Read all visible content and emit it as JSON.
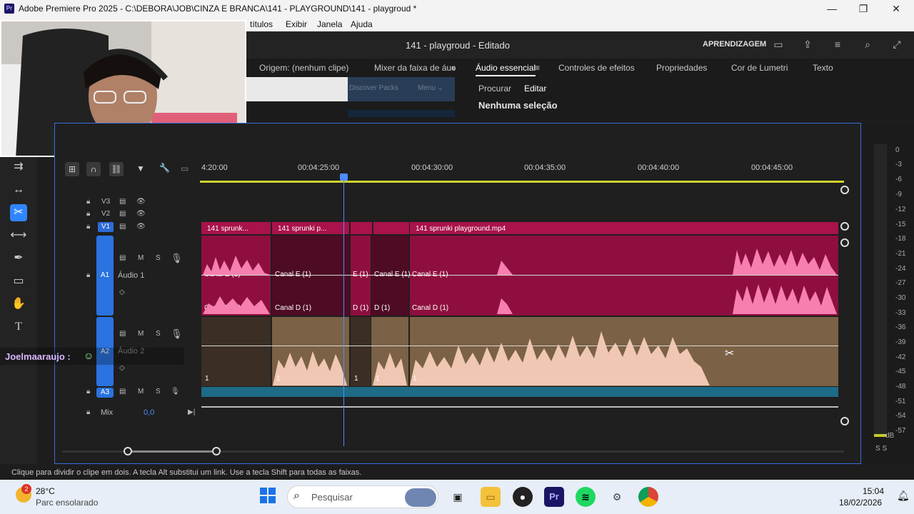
{
  "titlebar": {
    "app_icon": "Pr",
    "title": "Adobe Premiere Pro 2025 - C:\\DEBORA\\JOB\\CINZA E BRANCA\\141 - PLAYGROUND\\141 - playgroud *",
    "minimize_icon": "—",
    "restore_icon": "❐",
    "close_icon": "✕"
  },
  "menu": [
    "títulos",
    "Exibir",
    "Janela",
    "Ajuda"
  ],
  "header": {
    "project_title": "141 - playgroud - Editado",
    "learn": "APRENDIZAGEM"
  },
  "tabs": {
    "source": "Origem: (nenhum clipe)",
    "mixer": "Mixer da faixa de áuc",
    "more": "»",
    "essential_audio": "Áudio essencial",
    "effect_controls": "Controles de efeitos",
    "properties": "Propriedades",
    "lumetri": "Cor de Lumetri",
    "text": "Texto"
  },
  "source_preview": {
    "discover": "Discover Packs",
    "menu": "Menu ⌄"
  },
  "essential_audio": {
    "browse": "Procurar",
    "edit": "Editar",
    "no_selection": "Nenhuma seleção"
  },
  "ruler": {
    "timecodes": [
      "4:20:00",
      "00:04:25:00",
      "00:04:30:00",
      "00:04:35:00",
      "00:04:40:00",
      "00:04:45:00"
    ]
  },
  "tracks": {
    "v3": "V3",
    "v2": "V2",
    "v1": "V1",
    "a1": "A1",
    "a1_name": "Áudio 1",
    "a2": "A2",
    "a2_name": "Áudio 2",
    "a3": "A3",
    "mix": "Mix",
    "mix_value": "0,0",
    "m": "M",
    "s": "S"
  },
  "clips": {
    "v1": [
      "141 sprunk...",
      "141 sprunki p...",
      "141 sprunki playground.mp4"
    ],
    "ch_left": "Canal E (1)",
    "ch_right": "Canal D (1)",
    "e_short": "E (1)",
    "d_short": "D (1)",
    "one": "1"
  },
  "meter": {
    "db_labels": [
      "0",
      "-3",
      "-6",
      "-9",
      "-12",
      "-15",
      "-18",
      "-21",
      "-24",
      "-27",
      "-30",
      "-33",
      "-36",
      "-39",
      "-42",
      "-45",
      "-48",
      "-51",
      "-54",
      "-57",
      "dB"
    ],
    "solo": "S S"
  },
  "chat": {
    "name": "Joelmaaraujo :"
  },
  "status": "Clique para dividir o clipe em dois. A tecla Alt substitui um link. Use a tecla Shift para todas as faixas.",
  "taskbar": {
    "weather_temp": "28°C",
    "weather_desc": "Parc ensolarado",
    "weather_badge": "2",
    "search": "Pesquisar",
    "time": "15:04",
    "date": "18/02/2026"
  }
}
